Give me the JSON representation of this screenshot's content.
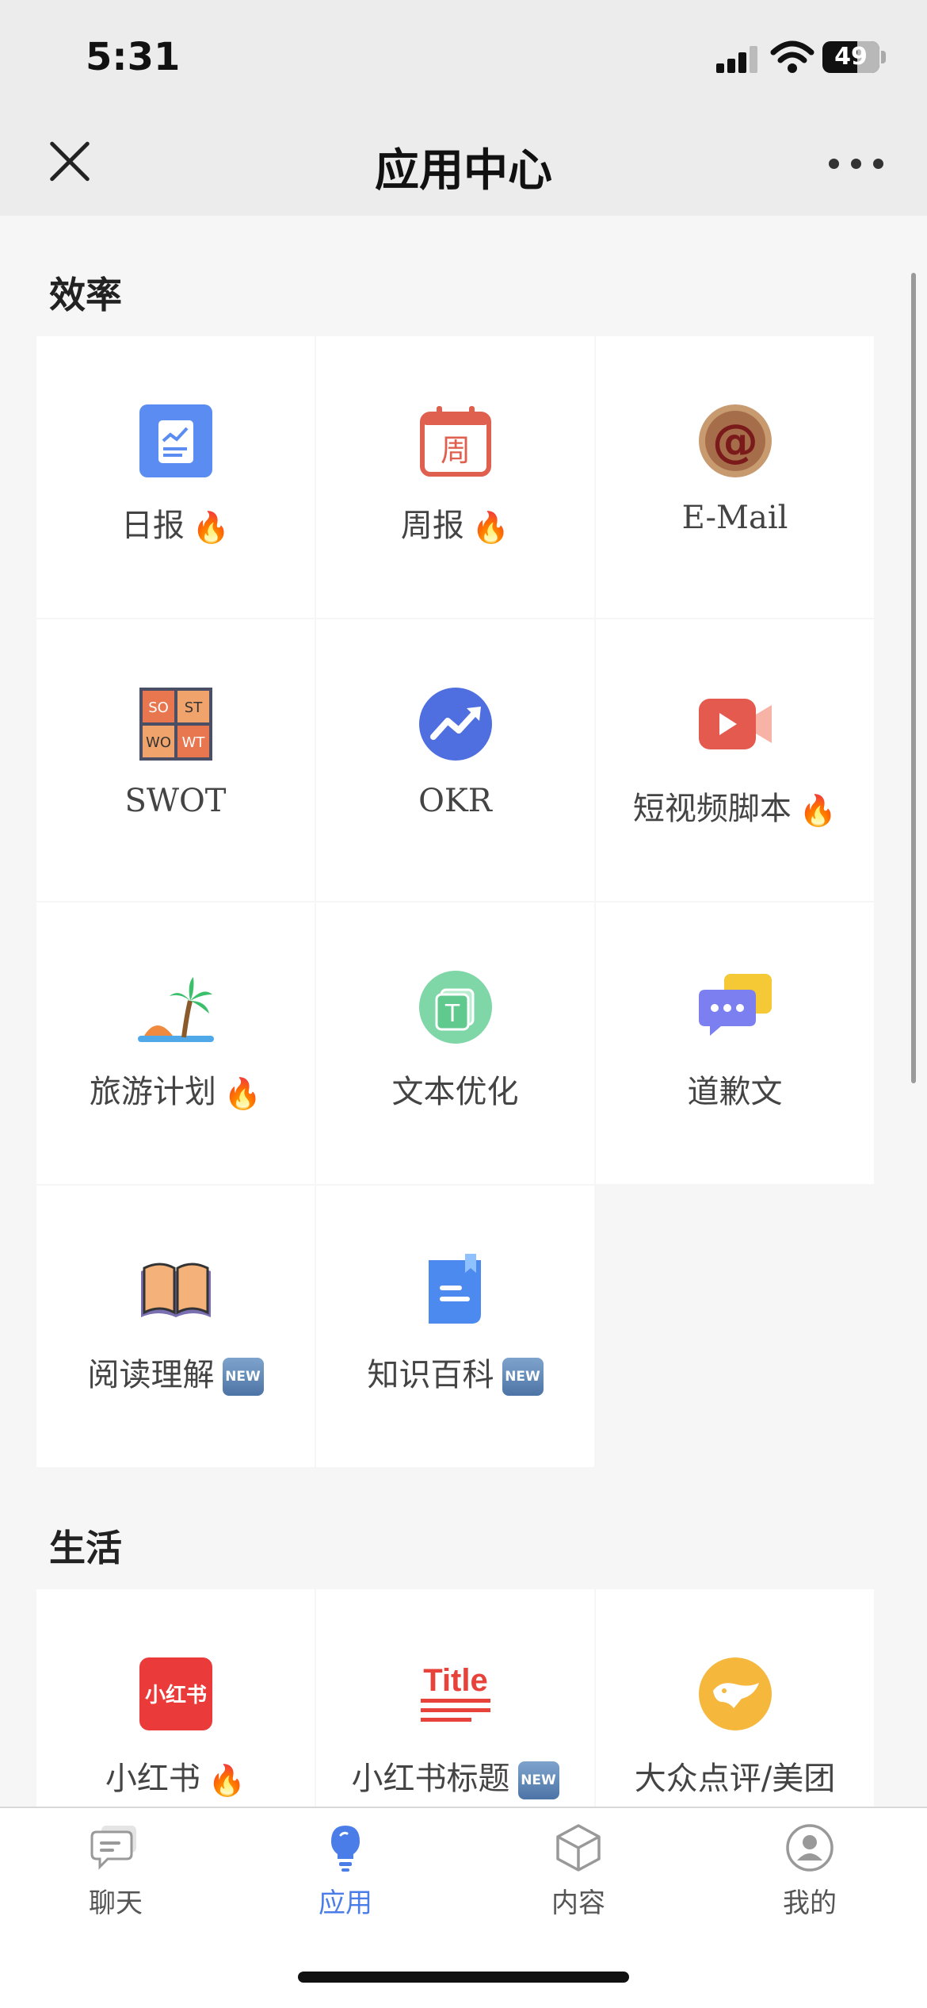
{
  "status_bar": {
    "time": "5:31",
    "battery": "49"
  },
  "header": {
    "title": "应用中心"
  },
  "sections": [
    {
      "title": "效率",
      "items": [
        {
          "label": "日报",
          "icon": "daily-report-icon",
          "badge": "🔥"
        },
        {
          "label": "周报",
          "icon": "weekly-report-icon",
          "badge": "🔥"
        },
        {
          "label": "E-Mail",
          "icon": "email-icon",
          "badge": ""
        },
        {
          "label": "SWOT",
          "icon": "swot-icon",
          "badge": ""
        },
        {
          "label": "OKR",
          "icon": "okr-icon",
          "badge": ""
        },
        {
          "label": "短视频脚本",
          "icon": "video-script-icon",
          "badge": "🔥"
        },
        {
          "label": "旅游计划",
          "icon": "travel-plan-icon",
          "badge": "🔥"
        },
        {
          "label": "文本优化",
          "icon": "text-optimize-icon",
          "badge": ""
        },
        {
          "label": "道歉文",
          "icon": "apology-icon",
          "badge": ""
        },
        {
          "label": "阅读理解",
          "icon": "reading-icon",
          "badge": "NEW"
        },
        {
          "label": "知识百科",
          "icon": "encyclopedia-icon",
          "badge": "NEW"
        }
      ]
    },
    {
      "title": "生活",
      "items": [
        {
          "label": "小红书",
          "icon": "xiaohongshu-icon",
          "badge": "🔥"
        },
        {
          "label": "小红书标题",
          "icon": "xiaohongshu-title-icon",
          "badge": "NEW"
        },
        {
          "label": "大众点评/美团",
          "icon": "dianping-icon",
          "badge": ""
        }
      ]
    }
  ],
  "icon_text": {
    "weekly": "周",
    "swot": [
      "SO",
      "ST",
      "WO",
      "WT"
    ],
    "xhs": "小红书",
    "title": "Title"
  },
  "tabs": [
    {
      "label": "聊天",
      "icon": "chat-icon",
      "active": false
    },
    {
      "label": "应用",
      "icon": "lightbulb-icon",
      "active": true
    },
    {
      "label": "内容",
      "icon": "cube-icon",
      "active": false
    },
    {
      "label": "我的",
      "icon": "profile-icon",
      "active": false
    }
  ],
  "colors": {
    "accent": "#4a7de8",
    "fire": "#f06a2a",
    "new_badge": "#5b80b0"
  }
}
